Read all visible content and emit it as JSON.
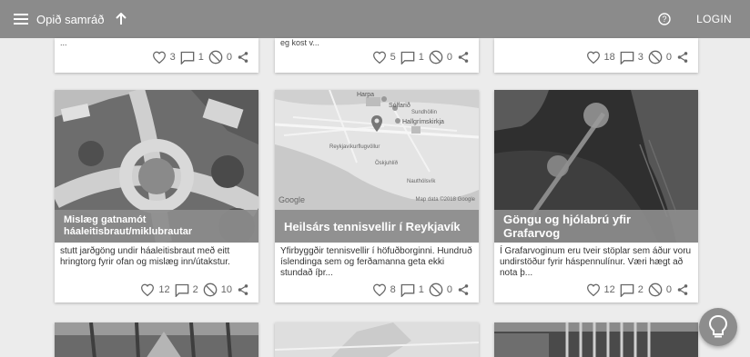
{
  "app": {
    "title": "Opið samráð",
    "login_label": "LOGIN"
  },
  "icons": {
    "menu": "menu-icon",
    "up": "arrow-up-icon",
    "help": "help-circle-icon",
    "like": "heart-icon",
    "comment": "comment-icon",
    "block": "block-icon",
    "share": "share-icon",
    "idea": "lightbulb-icon"
  },
  "top_cards": [
    {
      "snippet": "...",
      "likes": "3",
      "comments": "1",
      "blocks": "0"
    },
    {
      "snippet": "eg kost v...",
      "likes": "5",
      "comments": "1",
      "blocks": "0"
    },
    {
      "snippet": "",
      "likes": "18",
      "comments": "3",
      "blocks": "0"
    }
  ],
  "cards": [
    {
      "title": "Mislæg gatnamót háaleitisbraut/miklubrautar",
      "description": "stutt jarðgöng undir háaleitisbraut með eitt hringtorg fyrir ofan og mislæg inn/útakstur.",
      "likes": "12",
      "comments": "2",
      "blocks": "10"
    },
    {
      "title": "Heilsárs tennisvellir í Reykjavík",
      "description": "Yfirbyggðir tennisvellir í höfuðborginni. Hundruð íslendinga sem og ferðamanna geta ekki stundað íþr...",
      "likes": "8",
      "comments": "1",
      "blocks": "0",
      "map": {
        "attribution": "Map data ©2018 Google",
        "provider": "Google",
        "labels": [
          "Harpa",
          "Sólfarið",
          "Hallgrímskirkja",
          "Reykjavíkurflugvöllur",
          "Nauthólsvík",
          "Öskjuhlíð",
          "Sundhöllin"
        ]
      }
    },
    {
      "title": "Göngu og hjólabrú yfir Grafarvog",
      "description": "Í Grafarvoginum eru tveir stöplar sem áður voru undirstöður fyrir háspennulínur. Væri hægt að nota þ...",
      "likes": "12",
      "comments": "2",
      "blocks": "0"
    }
  ],
  "colors": {
    "header_bg": "#8b8b8b",
    "title_bar": "#8c8c8c",
    "page_bg": "#ececec"
  }
}
